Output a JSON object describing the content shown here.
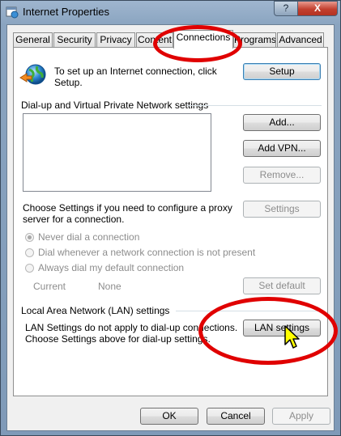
{
  "window": {
    "title": "Internet Properties",
    "help_label": "?",
    "close_label": "X"
  },
  "tabs": [
    {
      "label": "General"
    },
    {
      "label": "Security"
    },
    {
      "label": "Privacy"
    },
    {
      "label": "Content"
    },
    {
      "label": "Connections"
    },
    {
      "label": "Programs"
    },
    {
      "label": "Advanced"
    }
  ],
  "setup": {
    "text_line1": "To set up an Internet connection, click",
    "text_line2": "Setup.",
    "button": "Setup"
  },
  "dialup": {
    "heading": "Dial-up and Virtual Private Network settings",
    "add": "Add...",
    "add_vpn": "Add VPN...",
    "remove": "Remove...",
    "proxy_line1": "Choose Settings if you need to configure a proxy",
    "proxy_line2": "server for a connection.",
    "settings": "Settings",
    "radio_never": "Never dial a connection",
    "radio_whenever": "Dial whenever a network connection is not present",
    "radio_always": "Always dial my default connection",
    "current_label": "Current",
    "current_value": "None",
    "set_default": "Set default"
  },
  "lan": {
    "heading": "Local Area Network (LAN) settings",
    "text_line1": "LAN Settings do not apply to dial-up connections.",
    "text_line2": "Choose Settings above for dial-up settings.",
    "button": "LAN settings"
  },
  "footer": {
    "ok": "OK",
    "cancel": "Cancel",
    "apply": "Apply"
  },
  "colors": {
    "annotation": "#e00000",
    "accent": "#3c7fb1"
  }
}
